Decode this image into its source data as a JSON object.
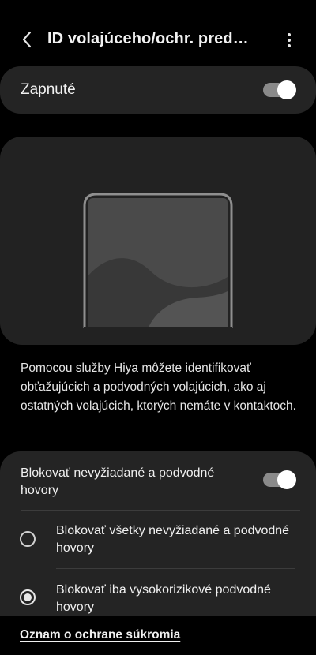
{
  "header": {
    "title": "ID volajúceho/ochr. pred…",
    "back_icon": "chevron-left-icon",
    "more_icon": "more-vert-icon"
  },
  "master_toggle": {
    "label": "Zapnuté",
    "on": true
  },
  "description": "Pomocou služby Hiya môžete identifikovať obťažujúcich a podvodných volajúcich, ako aj ostatných volajúcich, ktorých nemáte v kontaktoch.",
  "blocking": {
    "label": "Blokovať nevyžiadané a podvodné hovory",
    "on": true,
    "options": [
      {
        "label": "Blokovať všetky nevyžiadané a podvodné hovory",
        "selected": false
      },
      {
        "label": "Blokovať iba vysokorizikové podvodné hovory",
        "selected": true
      }
    ]
  },
  "footer": {
    "privacy_link": "Oznam o ochrane súkromia"
  },
  "colors": {
    "background": "#000000",
    "card": "#242424",
    "switch_track": "#8a8a8a",
    "text": "#f0f0f0"
  }
}
